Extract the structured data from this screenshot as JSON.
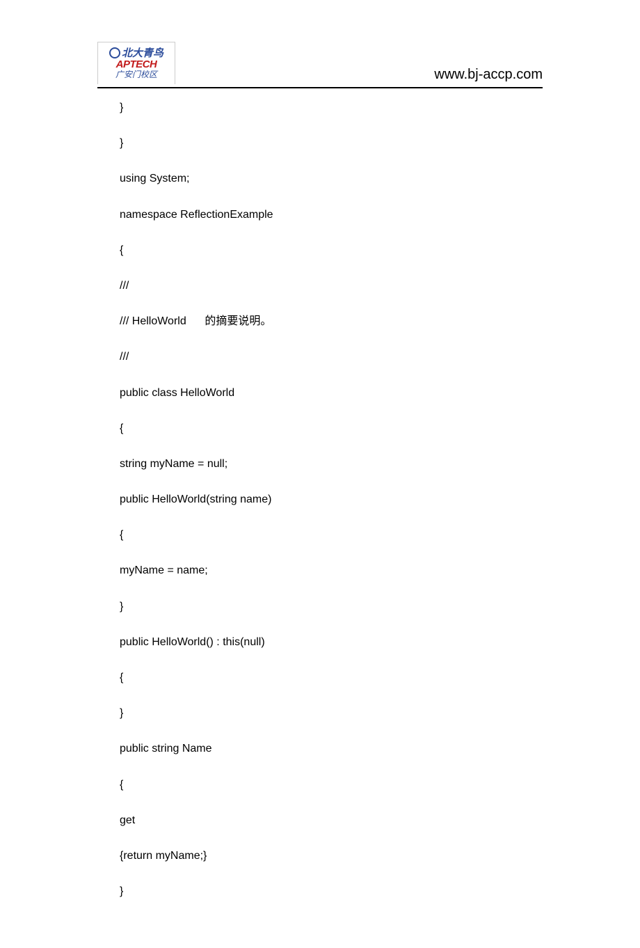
{
  "header": {
    "logo_row1": "北大青鸟",
    "logo_row2": "APTECH",
    "logo_row3": "广安门校区",
    "url": "www.bj-accp.com"
  },
  "lines": [
    "}",
    "}",
    "using System;",
    "namespace ReflectionExample",
    "{",
    "///",
    "/// HelloWorld      的摘要说明。",
    "///",
    "public class HelloWorld",
    "{",
    "string myName = null;",
    "public HelloWorld(string name)",
    "{",
    "myName = name;",
    "}",
    "public HelloWorld() : this(null)",
    "{",
    "}",
    "public string Name",
    "{",
    "get",
    "{return myName;}",
    "}"
  ]
}
